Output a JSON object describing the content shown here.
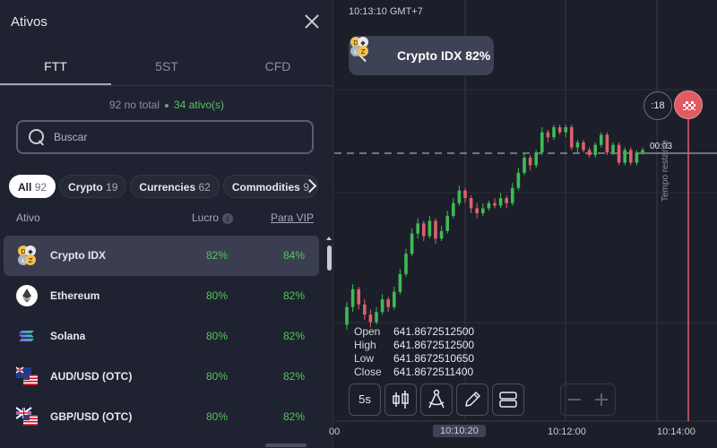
{
  "panel": {
    "title": "Ativos",
    "tabs": [
      {
        "label": "FTT",
        "active": true
      },
      {
        "label": "5ST",
        "active": false
      },
      {
        "label": "CFD",
        "active": false
      }
    ],
    "totals": {
      "total_text": "92 no total",
      "active_text": "34 ativo(s)"
    },
    "search": {
      "placeholder": "Buscar"
    },
    "categories": [
      {
        "label": "All",
        "count": "92",
        "active": true
      },
      {
        "label": "Crypto",
        "count": "19",
        "active": false
      },
      {
        "label": "Currencies",
        "count": "62",
        "active": false
      },
      {
        "label": "Commodities",
        "count": "9",
        "active": false
      }
    ],
    "columns": {
      "asset": "Ativo",
      "profit": "Lucro",
      "vip": "Para VIP"
    },
    "assets": [
      {
        "name": "Crypto IDX",
        "profit": "82%",
        "vip": "84%",
        "icon": "crypto-idx-icon",
        "selected": true
      },
      {
        "name": "Ethereum",
        "profit": "80%",
        "vip": "82%",
        "icon": "ethereum-icon",
        "selected": false
      },
      {
        "name": "Solana",
        "profit": "80%",
        "vip": "82%",
        "icon": "solana-icon",
        "selected": false
      },
      {
        "name": "AUD/USD (OTC)",
        "profit": "80%",
        "vip": "82%",
        "icon": "aud-usd-flag-icon",
        "selected": false
      },
      {
        "name": "GBP/USD (OTC)",
        "profit": "80%",
        "vip": "82%",
        "icon": "gbp-usd-flag-icon",
        "selected": false
      }
    ]
  },
  "chart": {
    "clock": "10:13:10 GMT+7",
    "asset_pill": "Crypto IDX 82%",
    "timer": ":18",
    "countdown": "00:03",
    "tempo_label": "Tempo restante",
    "ohlc": [
      {
        "key": "Open",
        "value": "641.8672512500"
      },
      {
        "key": "High",
        "value": "641.8672512500"
      },
      {
        "key": "Low",
        "value": "641.8672510650"
      },
      {
        "key": "Close",
        "value": "641.8672511400"
      }
    ],
    "timeframe": "5s",
    "x_labels": {
      "left": "00",
      "current": "10:10:20",
      "mid": "10:12:00",
      "right": "10:14:00"
    },
    "colors": {
      "up": "#3dbb54",
      "down": "#e0606a",
      "background": "#1c1f2a"
    },
    "candles": [
      {
        "o": 622.0,
        "c": 625.5,
        "h": 626.5,
        "l": 621.0
      },
      {
        "o": 625.5,
        "c": 629.0,
        "h": 630.0,
        "l": 624.5
      },
      {
        "o": 629.0,
        "c": 626.0,
        "h": 629.5,
        "l": 625.0
      },
      {
        "o": 626.0,
        "c": 624.0,
        "h": 627.0,
        "l": 623.0
      },
      {
        "o": 624.0,
        "c": 622.5,
        "h": 625.0,
        "l": 621.5
      },
      {
        "o": 622.5,
        "c": 624.5,
        "h": 625.5,
        "l": 622.0
      },
      {
        "o": 624.5,
        "c": 627.0,
        "h": 628.0,
        "l": 624.0
      },
      {
        "o": 627.0,
        "c": 625.5,
        "h": 627.5,
        "l": 624.5
      },
      {
        "o": 625.5,
        "c": 628.5,
        "h": 629.5,
        "l": 625.0
      },
      {
        "o": 628.5,
        "c": 632.0,
        "h": 633.0,
        "l": 628.0
      },
      {
        "o": 632.0,
        "c": 636.0,
        "h": 637.0,
        "l": 631.5
      },
      {
        "o": 636.0,
        "c": 640.0,
        "h": 641.0,
        "l": 635.5
      },
      {
        "o": 640.0,
        "c": 642.0,
        "h": 643.0,
        "l": 639.0
      },
      {
        "o": 642.0,
        "c": 639.5,
        "h": 642.5,
        "l": 638.5
      },
      {
        "o": 639.5,
        "c": 642.5,
        "h": 643.5,
        "l": 639.0
      },
      {
        "o": 642.5,
        "c": 639.0,
        "h": 643.0,
        "l": 638.0
      },
      {
        "o": 639.0,
        "c": 640.5,
        "h": 641.5,
        "l": 638.5
      },
      {
        "o": 640.5,
        "c": 643.5,
        "h": 644.5,
        "l": 640.0
      },
      {
        "o": 643.5,
        "c": 646.0,
        "h": 647.0,
        "l": 643.0
      },
      {
        "o": 646.0,
        "c": 648.5,
        "h": 649.5,
        "l": 645.5
      },
      {
        "o": 648.5,
        "c": 647.0,
        "h": 649.0,
        "l": 646.0
      },
      {
        "o": 647.0,
        "c": 645.0,
        "h": 647.5,
        "l": 644.0
      },
      {
        "o": 645.0,
        "c": 644.0,
        "h": 646.0,
        "l": 643.0
      },
      {
        "o": 644.0,
        "c": 645.0,
        "h": 646.0,
        "l": 643.5
      },
      {
        "o": 645.0,
        "c": 646.0,
        "h": 646.5,
        "l": 644.5
      },
      {
        "o": 646.0,
        "c": 645.5,
        "h": 647.0,
        "l": 645.0
      },
      {
        "o": 645.5,
        "c": 647.0,
        "h": 648.0,
        "l": 645.0
      },
      {
        "o": 647.0,
        "c": 646.0,
        "h": 647.5,
        "l": 645.0
      },
      {
        "o": 646.0,
        "c": 649.0,
        "h": 650.0,
        "l": 645.5
      },
      {
        "o": 649.0,
        "c": 652.0,
        "h": 653.0,
        "l": 648.5
      },
      {
        "o": 652.0,
        "c": 655.0,
        "h": 656.0,
        "l": 651.5
      },
      {
        "o": 655.0,
        "c": 653.5,
        "h": 655.5,
        "l": 652.5
      },
      {
        "o": 653.5,
        "c": 656.0,
        "h": 656.5,
        "l": 653.0
      },
      {
        "o": 656.0,
        "c": 660.0,
        "h": 661.0,
        "l": 655.5
      },
      {
        "o": 660.0,
        "c": 659.0,
        "h": 660.5,
        "l": 658.0
      },
      {
        "o": 659.0,
        "c": 661.0,
        "h": 661.5,
        "l": 658.5
      },
      {
        "o": 661.0,
        "c": 660.0,
        "h": 661.5,
        "l": 659.5
      },
      {
        "o": 660.0,
        "c": 661.0,
        "h": 661.5,
        "l": 659.0
      },
      {
        "o": 661.0,
        "c": 657.0,
        "h": 661.5,
        "l": 656.5
      },
      {
        "o": 657.0,
        "c": 658.0,
        "h": 658.5,
        "l": 656.0
      },
      {
        "o": 658.0,
        "c": 656.5,
        "h": 658.5,
        "l": 656.0
      },
      {
        "o": 656.5,
        "c": 655.5,
        "h": 657.0,
        "l": 655.0
      },
      {
        "o": 655.5,
        "c": 657.5,
        "h": 658.0,
        "l": 655.0
      },
      {
        "o": 657.5,
        "c": 659.5,
        "h": 660.0,
        "l": 657.0
      },
      {
        "o": 659.5,
        "c": 656.0,
        "h": 660.0,
        "l": 655.5
      },
      {
        "o": 656.0,
        "c": 657.5,
        "h": 658.0,
        "l": 655.5
      },
      {
        "o": 657.5,
        "c": 654.0,
        "h": 658.0,
        "l": 653.5
      },
      {
        "o": 654.0,
        "c": 656.5,
        "h": 657.0,
        "l": 653.5
      },
      {
        "o": 656.5,
        "c": 654.0,
        "h": 657.0,
        "l": 653.5
      },
      {
        "o": 654.0,
        "c": 656.0,
        "h": 656.5,
        "l": 653.5
      },
      {
        "o": 656.0,
        "c": 656.5,
        "h": 657.0,
        "l": 655.5
      }
    ]
  }
}
